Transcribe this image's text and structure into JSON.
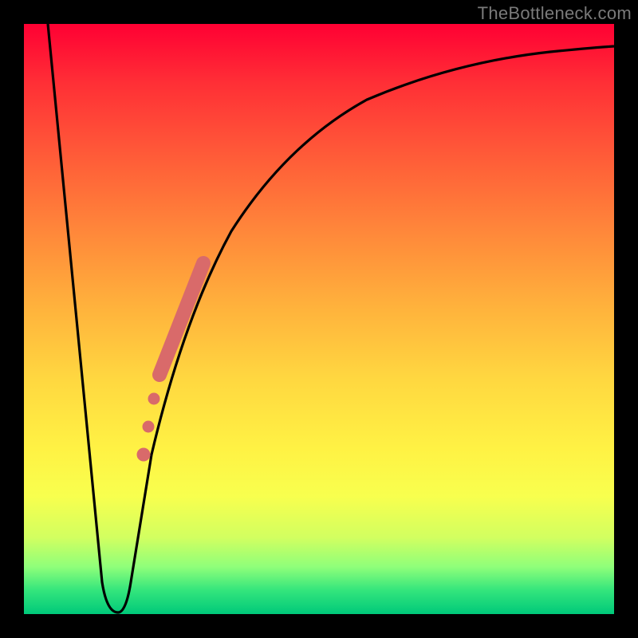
{
  "watermark": "TheBottleneck.com",
  "chart_data": {
    "type": "line",
    "title": "",
    "xlabel": "",
    "ylabel": "",
    "xlim": [
      0,
      100
    ],
    "ylim": [
      0,
      100
    ],
    "series": [
      {
        "name": "bottleneck-curve",
        "x": [
          0,
          5,
          10,
          12,
          14,
          16,
          20,
          25,
          30,
          35,
          40,
          50,
          60,
          70,
          80,
          90,
          100
        ],
        "y": [
          100,
          60,
          5,
          0,
          0,
          5,
          25,
          45,
          58,
          67,
          74,
          83,
          88,
          91,
          93,
          94.5,
          95.5
        ]
      }
    ],
    "highlight_segment": {
      "name": "highlighted-range",
      "color": "#d96a6a",
      "points": [
        {
          "x": 19.5,
          "y": 22,
          "r": 6
        },
        {
          "x": 20.5,
          "y": 27,
          "r": 6
        },
        {
          "x": 21.5,
          "y": 32,
          "r": 6
        },
        {
          "x": 23,
          "y": 39,
          "r": 9
        },
        {
          "x": 25,
          "y": 46,
          "r": 9
        },
        {
          "x": 27,
          "y": 52,
          "r": 9
        },
        {
          "x": 29,
          "y": 57,
          "r": 9
        }
      ]
    },
    "gradient_stops": [
      {
        "pos": 0,
        "color": "#ff0033"
      },
      {
        "pos": 50,
        "color": "#ffd040"
      },
      {
        "pos": 80,
        "color": "#fff244"
      },
      {
        "pos": 100,
        "color": "#00c97a"
      }
    ]
  }
}
